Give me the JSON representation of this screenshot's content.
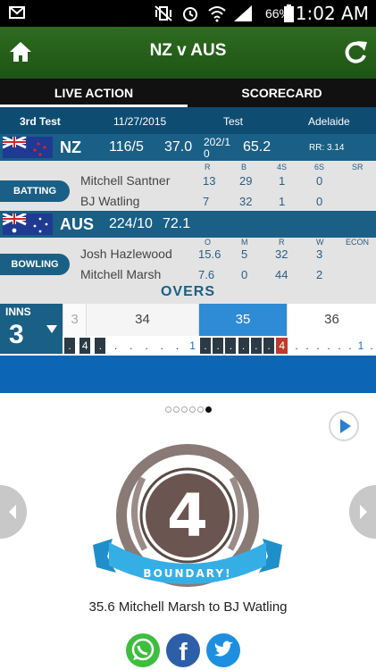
{
  "status_bar": {
    "battery": "66%",
    "time": "1:02 AM"
  },
  "header": {
    "title": "NZ v AUS",
    "home_icon": "home-icon",
    "refresh_icon": "refresh-icon"
  },
  "tabs": [
    {
      "label": "LIVE ACTION",
      "active": true
    },
    {
      "label": "SCORECARD",
      "active": false
    }
  ],
  "match": {
    "test_no": "3rd Test",
    "date": "11/27/2015",
    "format": "Test",
    "venue": "Adelaide"
  },
  "batting_team": {
    "code": "NZ",
    "score": "116/5",
    "overs": "37.0",
    "target_line1": "202/1",
    "target_line2": "0",
    "target_overs": "65.2",
    "run_rate": "RR: 3.14"
  },
  "batting": {
    "label": "BATTING",
    "columns": [
      "R",
      "B",
      "4S",
      "6S",
      "SR"
    ],
    "rows": [
      {
        "name": "Mitchell Santner",
        "r": "13",
        "b": "29",
        "fours": "1",
        "sixes": "0",
        "sr": ""
      },
      {
        "name": "BJ Watling",
        "r": "7",
        "b": "32",
        "fours": "1",
        "sixes": "0",
        "sr": ""
      }
    ]
  },
  "bowling_team": {
    "code": "AUS",
    "score": "224/10",
    "overs": "72.1"
  },
  "bowling": {
    "label": "BOWLING",
    "columns": [
      "O",
      "M",
      "R",
      "W",
      "ECON"
    ],
    "rows": [
      {
        "name": "Josh Hazlewood",
        "o": "15.6",
        "m": "5",
        "r": "32",
        "w": "3",
        "econ": ""
      },
      {
        "name": "Mitchell Marsh",
        "o": "7.6",
        "m": "0",
        "r": "44",
        "w": "2",
        "econ": ""
      }
    ]
  },
  "overs": {
    "title": "OVERS",
    "inns_label": "INNS",
    "inns_value": "3",
    "cells": [
      "3",
      "34",
      "35",
      "36"
    ],
    "balls_34": [
      ".",
      "4",
      ".",
      ".",
      ".",
      ".",
      ".",
      ".",
      "1"
    ],
    "balls_35": [
      ".",
      ".",
      ".",
      ".",
      ".",
      ".",
      "4"
    ],
    "balls_36": [
      ".",
      ".",
      ".",
      ".",
      ".",
      ".",
      "1",
      "."
    ]
  },
  "carousel": {
    "pages": 6,
    "active_index": 5
  },
  "event": {
    "runs": "4",
    "ribbon": "BOUNDARY!",
    "commentary": "35.6 Mitchell Marsh to BJ Watling"
  },
  "share": [
    "whatsapp-icon",
    "facebook-icon",
    "twitter-icon"
  ]
}
